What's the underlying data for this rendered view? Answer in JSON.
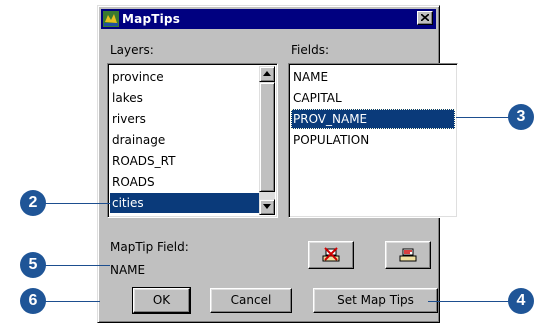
{
  "window": {
    "title": "MapTips"
  },
  "layers": {
    "label": "Layers:",
    "items": [
      "province",
      "lakes",
      "rivers",
      "drainage",
      "ROADS_RT",
      "ROADS",
      "cities"
    ],
    "selected": "cities"
  },
  "fields": {
    "label": "Fields:",
    "items": [
      "NAME",
      "CAPITAL",
      "PROV_NAME",
      "POPULATION"
    ],
    "selected": "PROV_NAME"
  },
  "maptip": {
    "label": "MapTip Field:",
    "value": "NAME"
  },
  "buttons": {
    "ok": "OK",
    "cancel": "Cancel",
    "set": "Set Map Tips"
  },
  "callouts": [
    "2",
    "3",
    "4",
    "5",
    "6"
  ],
  "colors": {
    "callout": "#1f5597",
    "selection": "#0a3a7a",
    "titlebar": "#000080",
    "dialog": "#c0c0c0"
  },
  "icons": [
    "maptips-app-icon",
    "close-icon",
    "scroll-up-icon",
    "scroll-down-icon",
    "clear-maptip-icon",
    "set-maptip-icon"
  ]
}
